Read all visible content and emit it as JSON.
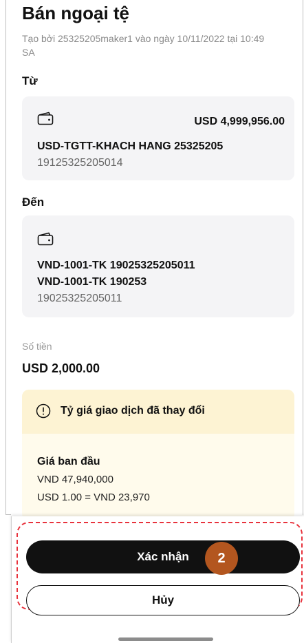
{
  "header": {
    "title": "Bán ngoại tệ",
    "subtitle": "Tạo bởi 25325205maker1 vào ngày 10/11/2022 tại 10:49 SA"
  },
  "from": {
    "label": "Từ",
    "icon": "wallet-icon",
    "balance": "USD 4,999,956.00",
    "account_name": "USD-TGTT-KHACH HANG 25325205",
    "account_number": "19125325205014"
  },
  "to": {
    "label": "Đến",
    "icon": "wallet-icon",
    "account_name_1": "VND-1001-TK 19025325205011",
    "account_name_2": "VND-1001-TK 190253",
    "account_number": "19025325205011"
  },
  "amount": {
    "label": "Số tiền",
    "value": "USD 2,000.00"
  },
  "rate_notice": {
    "icon": "info-circle-icon",
    "message": "Tỷ giá giao dịch đã thay đổi",
    "original_title": "Giá ban đầu",
    "original_total": "VND 47,940,000",
    "original_rate": "USD 1.00 = VND 23,970"
  },
  "actions": {
    "confirm_label": "Xác nhận",
    "cancel_label": "Hủy",
    "step_badge": "2"
  },
  "colors": {
    "highlight": "#e8323c",
    "badge": "#b3561f",
    "warn_header": "#fdf3d3",
    "warn_body": "#fffbec",
    "card": "#f4f4f6"
  }
}
